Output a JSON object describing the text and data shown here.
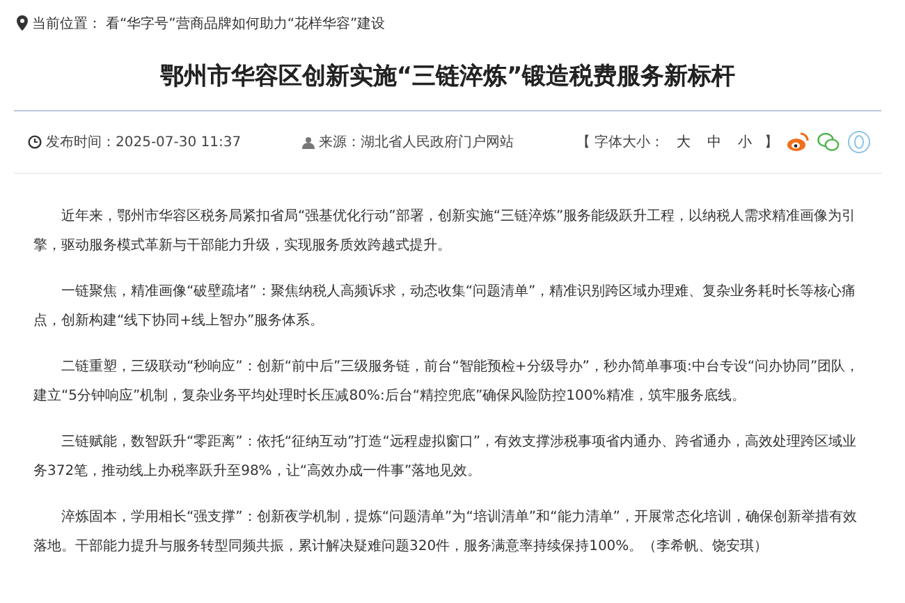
{
  "breadcrumb": {
    "label": "当前位置：",
    "current": "看“华字号”营商品牌如何助力“花样华容”建设"
  },
  "title": "鄂州市华容区创新实施“三链淬炼”锻造税费服务新标杆",
  "meta": {
    "publish_label": "发布时间：",
    "publish_time": "2025-07-30 11:37",
    "source_label": "来源：",
    "source": "湖北省人民政府门户网站",
    "font_size_open": "【 字体大小：",
    "font_size_options": [
      "大",
      "中",
      "小"
    ],
    "font_size_close": "】"
  },
  "paragraphs": [
    "近年来，鄂州市华容区税务局紧扣省局“强基优化行动”部署，创新实施“三链淬炼”服务能级跃升工程，以纳税人需求精准画像为引擎，驱动服务模式革新与干部能力升级，实现服务质效跨越式提升。",
    "一链聚焦，精准画像“破壁疏堵”：聚焦纳税人高频诉求，动态收集“问题清单”，精准识别跨区域办理难、复杂业务耗时长等核心痛点，创新构建“线下协同+线上智办”服务体系。",
    "二链重塑，三级联动“秒响应”：创新“前中后”三级服务链，前台“智能预检+分级导办”，秒办简单事项:中台专设“问办协同”团队，建立“5分钟响应”机制，复杂业务平均处理时长压减80%:后台“精控兜底”确保风险防控100%精准，筑牢服务底线。",
    "三链赋能，数智跃升“零距离”：依托“征纳互动”打造“远程虚拟窗口”，有效支撑涉税事项省内通办、跨省通办，高效处理跨区域业务372笔，推动线上办税率跃升至98%，让“高效办成一件事”落地见效。",
    "淬炼固本，学用相长“强支撑”：创新夜学机制，提炼“问题清单”为“培训清单”和“能力清单”，开展常态化培训，确保创新举措有效落地。干部能力提升与服务转型同频共振，累计解决疑难问题320件，服务满意率持续保持100%。（李希帆、饶安琪）"
  ]
}
